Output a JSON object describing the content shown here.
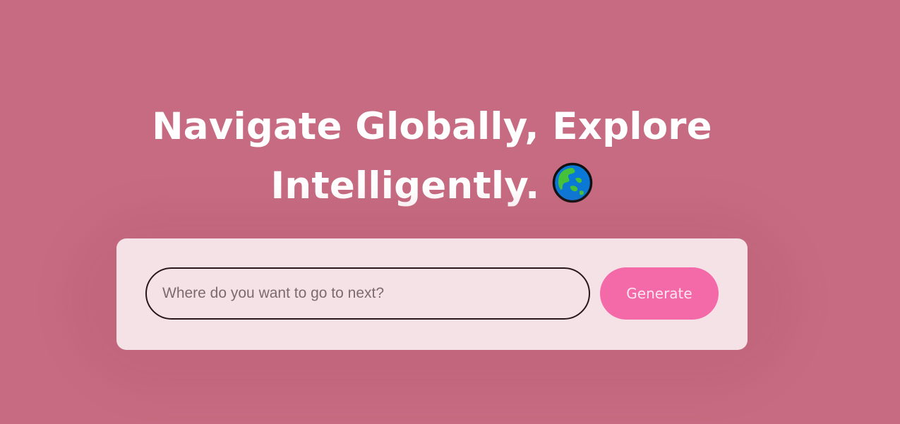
{
  "hero": {
    "title_line1": "Navigate Globally, Explore",
    "title_line2": "Intelligently.",
    "title_icon": "globe-asia-australia-icon"
  },
  "search": {
    "placeholder": "Where do you want to go to next?",
    "value": ""
  },
  "actions": {
    "generate_label": "Generate"
  },
  "colors": {
    "background": "#c66b81",
    "card": "#f4e2e7",
    "button": "#f46aa9",
    "title": "#ffffff"
  }
}
